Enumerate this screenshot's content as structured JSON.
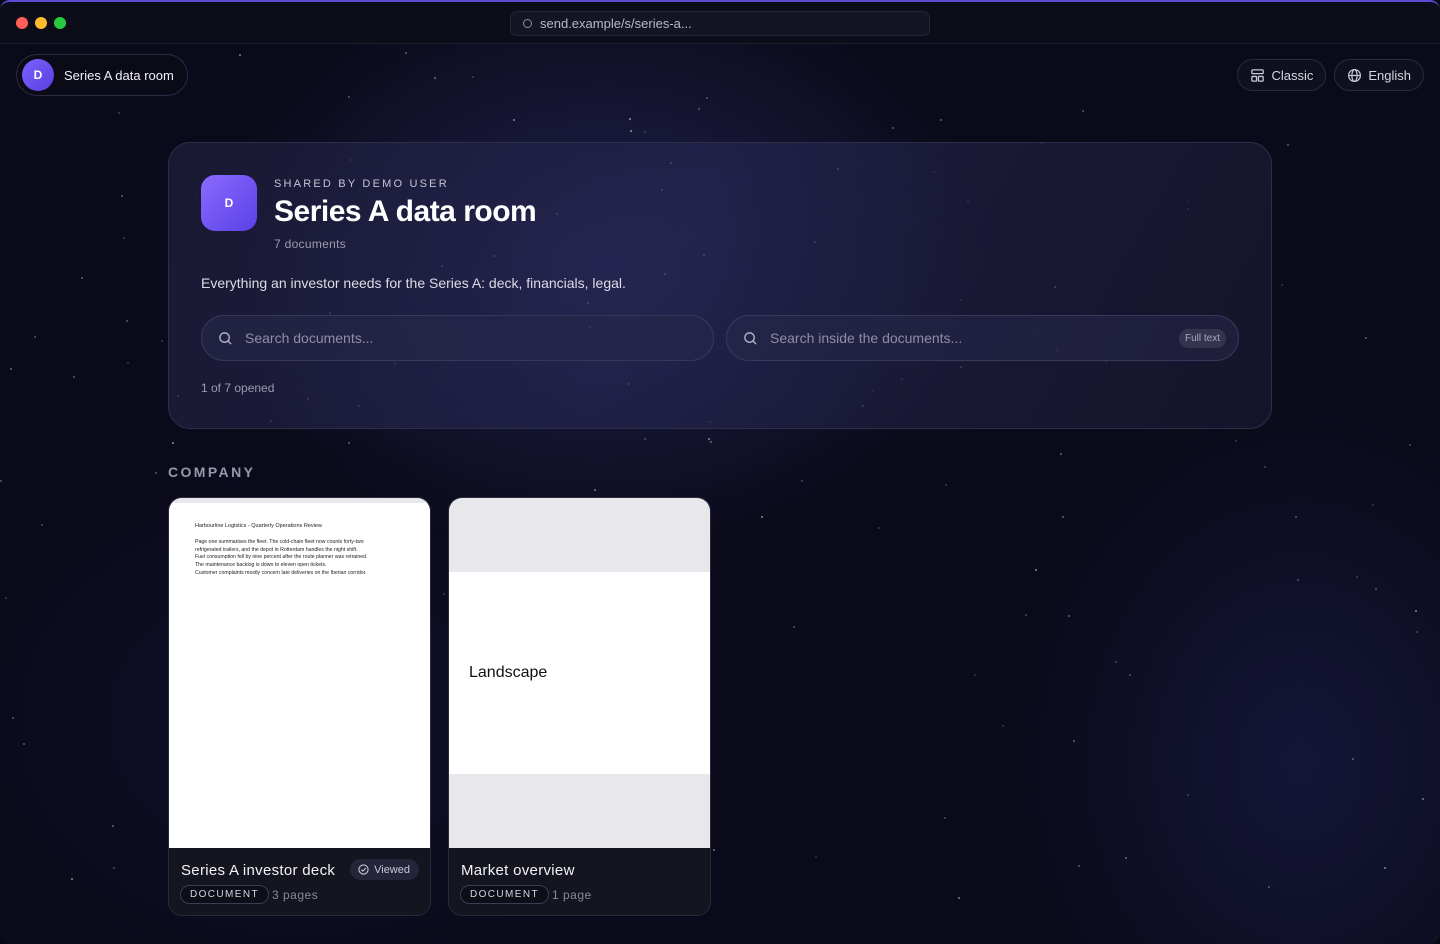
{
  "browser": {
    "url": "send.example/s/series-a..."
  },
  "topbar": {
    "room_initial": "D",
    "room_name": "Series A data room",
    "classic_label": "Classic",
    "language_label": "English"
  },
  "hero": {
    "avatar_initial": "D",
    "shared_by": "SHARED BY DEMO USER",
    "title": "Series A data room",
    "doc_count": "7 documents",
    "description": "Everything an investor needs for the Series A: deck, financials, legal.",
    "search_placeholder": "Search documents...",
    "fulltext_placeholder": "Search inside the documents...",
    "fulltext_badge": "Full text",
    "opened_status": "1 of 7 opened"
  },
  "section": {
    "label": "COMPANY"
  },
  "documents": [
    {
      "title": "Series A investor deck",
      "viewed_label": "Viewed",
      "type": "DOCUMENT",
      "pages": "3 pages",
      "preview_heading": "Harbourline Logistics - Quarterly Operations Review",
      "preview_lines": [
        "Page one summarises the fleet. The cold-chain fleet now counts forty-two",
        "refrigerated trailers, and the depot in Rotterdam handles the night shift.",
        "Fuel consumption fell by nine percent after the route planner was retrained.",
        "The maintenance backlog is down to eleven open tickets.",
        "Customer complaints mostly concern late deliveries on the Iberian corridor."
      ]
    },
    {
      "title": "Market overview",
      "type": "DOCUMENT",
      "pages": "1 page",
      "preview_text": "Landscape"
    }
  ],
  "colors": {
    "accent": "#6c52f5",
    "background": "#0a0a1a"
  }
}
